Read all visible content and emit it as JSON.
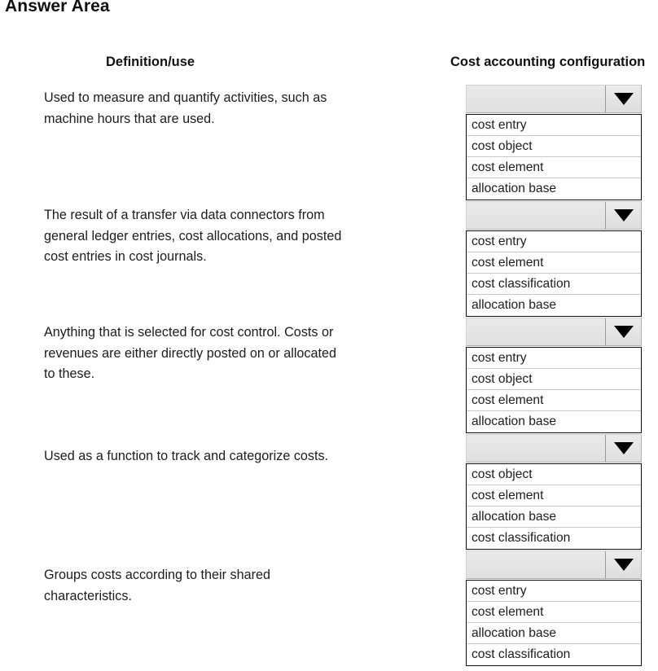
{
  "page": {
    "title": "Answer Area"
  },
  "headers": {
    "definition": "Definition/use",
    "configuration": "Cost accounting configuration"
  },
  "rows": [
    {
      "definition": "Used to measure and quantify activities, such as\nmachine hours that are used.",
      "dropdown": {
        "selected": "",
        "caret_icon": "chevron-down-icon",
        "options": [
          "cost entry",
          "cost object",
          "cost element",
          "allocation base"
        ]
      }
    },
    {
      "definition": "The result of a transfer via data connectors from\ngeneral ledger entries, cost allocations, and posted\ncost entries in cost journals.",
      "dropdown": {
        "selected": "",
        "caret_icon": "chevron-down-icon",
        "options": [
          "cost entry",
          "cost element",
          "cost classification",
          "allocation base"
        ]
      }
    },
    {
      "definition": "Anything that is selected for cost control. Costs or\nrevenues are either directly posted on or allocated\nto these.",
      "dropdown": {
        "selected": "",
        "caret_icon": "chevron-down-icon",
        "options": [
          "cost entry",
          "cost object",
          "cost element",
          "allocation base"
        ]
      }
    },
    {
      "definition": "Used as a function to track and categorize costs.",
      "dropdown": {
        "selected": "",
        "caret_icon": "chevron-down-icon",
        "options": [
          "cost object",
          "cost element",
          "allocation base",
          "cost classification"
        ]
      }
    },
    {
      "definition": "Groups costs according to their shared\ncharacteristics.",
      "dropdown": {
        "selected": "",
        "caret_icon": "chevron-down-icon",
        "options": [
          "cost entry",
          "cost element",
          "allocation base",
          "cost classification"
        ]
      }
    }
  ],
  "layout": {
    "row_tops": [
      104,
      247,
      390,
      533,
      676
    ],
    "definition_tops": [
      108,
      252,
      396,
      548,
      694
    ]
  },
  "colors": {
    "page_background": "#ffffff",
    "text": "#1c1c1c",
    "combo_face": "#e4e4e4",
    "list_border": "#111111",
    "row_separator": "#c8c8c8",
    "caret": "#000000"
  }
}
